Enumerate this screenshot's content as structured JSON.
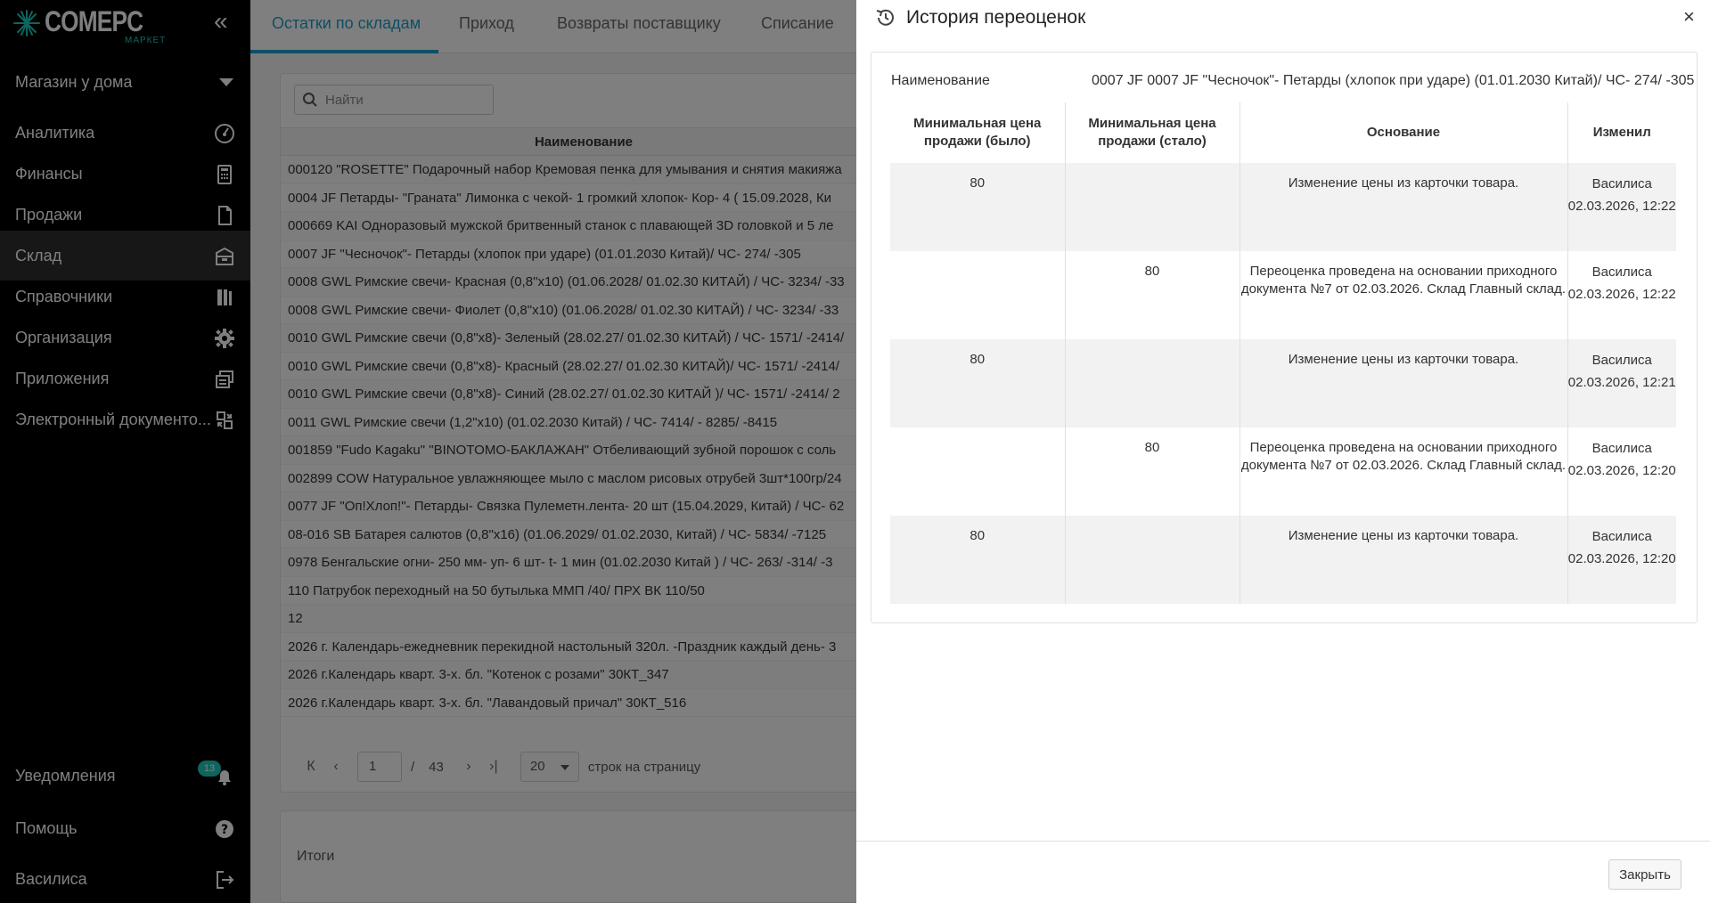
{
  "sidebar": {
    "logo_main": "COMEPC",
    "logo_sub": "МАРКЕТ",
    "collapse_icon": "«",
    "store": "Магазин у дома",
    "items": [
      {
        "label": "Аналитика",
        "icon": "gauge-icon"
      },
      {
        "label": "Финансы",
        "icon": "calculator-icon"
      },
      {
        "label": "Продажи",
        "icon": "document-icon"
      },
      {
        "label": "Склад",
        "icon": "warehouse-box-icon"
      },
      {
        "label": "Справочники",
        "icon": "books-icon"
      },
      {
        "label": "Организация",
        "icon": "gear-icon"
      },
      {
        "label": "Приложения",
        "icon": "windows-icon"
      },
      {
        "label": "Электронный документо...",
        "icon": "edi-icon"
      }
    ],
    "bottom": {
      "notifications": "Уведомления",
      "notifications_count": "13",
      "help": "Помощь",
      "user": "Василиса"
    }
  },
  "main": {
    "tabs": [
      "Остатки по складам",
      "Приход",
      "Возвраты поставщику",
      "Списание"
    ],
    "search_placeholder": "Найти",
    "column_name": "Наименование",
    "rows": [
      "000120 \"ROSETTE\" Подарочный набор Кремовая пенка для умывания и снятия макияжа",
      "0004 JF Петарды- \"Граната\" Лимонка с чекой- 1 громкий хлопок- Кор- 4 ( 15.09.2028, Ки",
      "000669 KAI Одноразовый мужской бритвенный станок с плавающей 3D головкой и 5 ле",
      "0007 JF \"Чесночок\"- Петарды (хлопок при ударе) (01.01.2030 Китай)/ ЧС- 274/ -305",
      "0008 GWL Римские свечи- Красная (0,8\"x10) (01.06.2028/ 01.02.30 КИТАЙ) / ЧС- 3234/ -33",
      "0008 GWL Римские свечи- Фиолет (0,8\"x10) (01.06.2028/ 01.02.30 КИТАЙ) / ЧС- 3234/ -33",
      "0010 GWL Римские свечи (0,8\"x8)- Зеленый (28.02.27/ 01.02.30 КИТАЙ) / ЧС- 1571/ -2414/",
      "0010 GWL Римские свечи (0,8\"x8)- Красный (28.02.27/ 01.02.30 КИТАЙ)/ ЧС- 1571/ -2414/",
      "0010 GWL Римские свечи (0,8\"x8)- Синий (28.02.27/ 01.02.30 КИТАЙ )/ ЧС- 1571/ -2414/ 2",
      "0011 GWL Римские свечи (1,2\"x10) (01.02.2030 Китай) / ЧС- 7414/ - 8285/ -8415",
      "001859 \"Fudo Kagaku\" \"BINOTOMO-БАКЛАЖАН\" Отбеливающий зубной порошок с соль",
      "002899 COW Натуральное увлажняющее мыло с маслом рисовых отрубей 3шт*100гр/24",
      "0077 JF \"Оп!Хлоп!\"- Петарды- Связка Пулеметн.лента- 20 шт (15.04.2029, Китай) / ЧС- 62",
      "08-016 SB Батарея салютов (0,8\"x16) (01.06.2029/ 01.02.2030, Китай) / ЧС- 5834/ -7125",
      "0978 Бенгальские огни- 250 мм- уп- 6 шт- t- 1 мин (01.02.2030 Китай ) / ЧС- 263/ -314/ -3",
      "110 Патрубок переходный на 50 бутылька ММП /40/ ПРХ ВК 110/50",
      "12",
      "2026 г. Календарь-ежедневник перекидной настольный 320л. -Праздник каждый день- 3",
      "2026 г.Календарь кварт. 3-х. бл. \"Котенок с розами\" 30КТ_347",
      "2026 г.Календарь кварт. 3-х. бл. \"Лавандовый причал\" 30КТ_516"
    ],
    "pager": {
      "first": "К",
      "prev": "‹",
      "page": "1",
      "separator": "/",
      "total_pages": "43",
      "next": "›",
      "last": "›|",
      "page_size": "20",
      "page_size_label": "строк на страницу"
    },
    "totals_label": "Итоги"
  },
  "drawer": {
    "title": "История переоценок",
    "close_x": "×",
    "name_label": "Наименование",
    "name_value": "0007 JF 0007 JF \"Чесночок\"- Петарды (хлопок при ударе) (01.01.2030 Китай)/ ЧС- 274/ -305",
    "columns": {
      "was": "Минимальная цена продажи (было)",
      "now": "Минимальная цена продажи (стало)",
      "reason": "Основание",
      "who": "Изменил"
    },
    "rows": [
      {
        "was": "80",
        "now": "",
        "reason": "Изменение цены из карточки товара.",
        "who": "Василиса 02.03.2026, 12:22"
      },
      {
        "was": "",
        "now": "80",
        "reason": "Переоценка проведена на основании приходного документа №7 от 02.03.2026. Склад Главный склад.",
        "who": "Василиса 02.03.2026, 12:22"
      },
      {
        "was": "80",
        "now": "",
        "reason": "Изменение цены из карточки товара.",
        "who": "Василиса 02.03.2026, 12:21"
      },
      {
        "was": "",
        "now": "80",
        "reason": "Переоценка проведена на основании приходного документа №7 от 02.03.2026. Склад Главный склад.",
        "who": "Василиса 02.03.2026, 12:20"
      },
      {
        "was": "80",
        "now": "",
        "reason": "Изменение цены из карточки товара.",
        "who": "Василиса 02.03.2026, 12:20"
      }
    ],
    "close_button": "Закрыть"
  },
  "colors": {
    "accent": "#1e9cc8",
    "badge": "#1ec8c0",
    "sidebar_bg": "#000000",
    "overlay": "rgba(0,0,0,0.5)"
  }
}
